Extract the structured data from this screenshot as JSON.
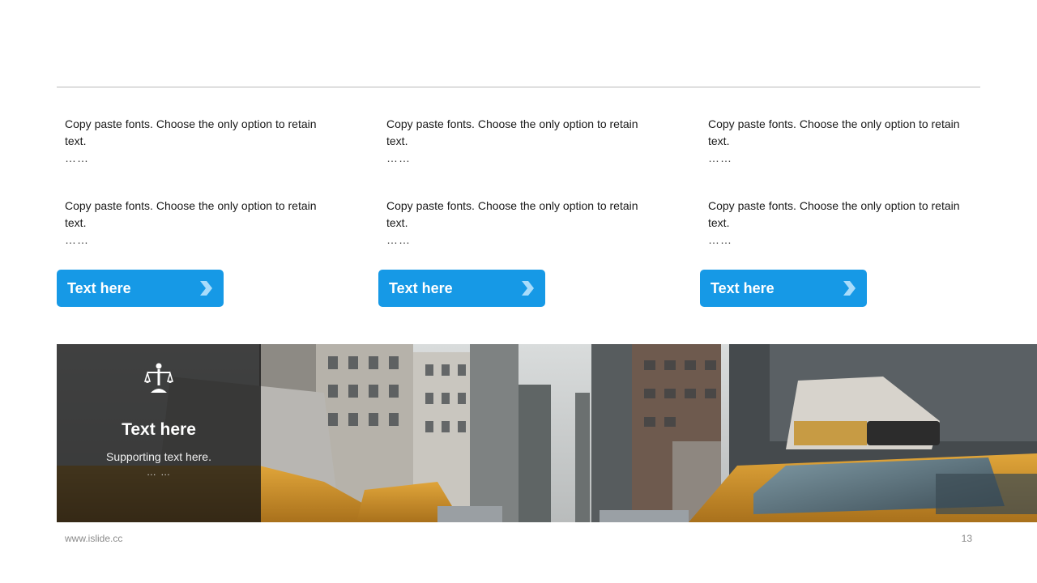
{
  "columns": [
    {
      "paragraphs": [
        {
          "text": "Copy paste fonts. Choose the only option to retain text.",
          "dots": "……"
        },
        {
          "text": "Copy paste fonts. Choose the only option to retain text.",
          "dots": "……"
        }
      ],
      "button_label": "Text here"
    },
    {
      "paragraphs": [
        {
          "text": "Copy paste fonts. Choose the only option to retain text.",
          "dots": "……"
        },
        {
          "text": "Copy paste fonts. Choose the only option to retain text.",
          "dots": "……"
        }
      ],
      "button_label": "Text here"
    },
    {
      "paragraphs": [
        {
          "text": "Copy paste fonts. Choose the only option to retain text.",
          "dots": "……"
        },
        {
          "text": "Copy paste fonts. Choose the only option to retain text.",
          "dots": "……"
        }
      ],
      "button_label": "Text here"
    }
  ],
  "banner": {
    "title": "Text here",
    "subtitle": "Supporting  text here.",
    "dots": "… …",
    "emblem_icon": "justice-scales-icon"
  },
  "footer": {
    "url": "www.islide.cc",
    "page_number": "13"
  },
  "colors": {
    "accent": "#1699e6",
    "overlay": "#141414",
    "rule": "#b9b9b9"
  }
}
